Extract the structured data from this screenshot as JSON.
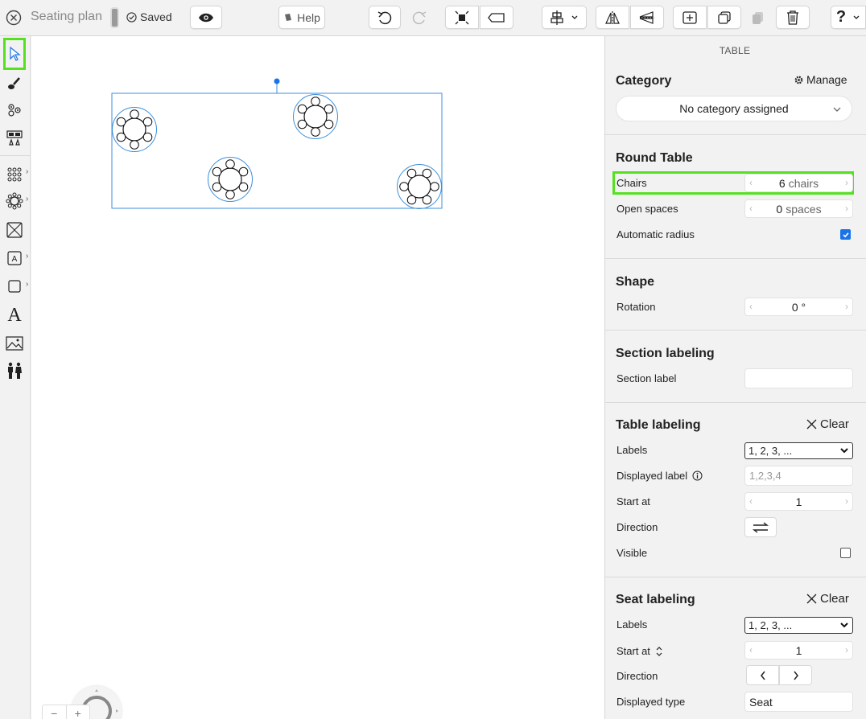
{
  "app": {
    "title": "Seating plan",
    "saved_label": "Saved",
    "help_label": "Help"
  },
  "toolbar": {
    "icons": [
      "close-icon",
      "eye-icon",
      "book-icon",
      "undo-icon",
      "redo-icon",
      "select-all-icon",
      "tag-icon",
      "align-icon",
      "flip-horizontal-icon",
      "flip-vertical-icon",
      "add-group-icon",
      "duplicate-icon",
      "paste-icon",
      "trash-icon",
      "help-icon"
    ]
  },
  "left_tools": [
    "select-icon",
    "brush-icon",
    "seats-icon",
    "tables-icon",
    "rows-icon",
    "round-table-icon",
    "area-icon",
    "label-icon",
    "shape-icon",
    "text-icon",
    "image-icon",
    "people-icon"
  ],
  "canvas": {
    "tables": [
      {
        "chairs": 6
      },
      {
        "chairs": 6
      },
      {
        "chairs": 6
      },
      {
        "chairs": 6
      }
    ]
  },
  "panel": {
    "title": "TABLE",
    "category": {
      "heading": "Category",
      "manage_label": "Manage",
      "selected": "No category assigned"
    },
    "round_table": {
      "heading": "Round Table",
      "chairs_label": "Chairs",
      "chairs_value": "6",
      "chairs_unit": "chairs",
      "open_spaces_label": "Open spaces",
      "open_spaces_value": "0",
      "open_spaces_unit": "spaces",
      "auto_radius_label": "Automatic radius",
      "auto_radius_checked": true
    },
    "shape": {
      "heading": "Shape",
      "rotation_label": "Rotation",
      "rotation_value": "0 °"
    },
    "section_labeling": {
      "heading": "Section labeling",
      "section_label_label": "Section label",
      "section_label_value": ""
    },
    "table_labeling": {
      "heading": "Table labeling",
      "clear_label": "Clear",
      "labels_label": "Labels",
      "labels_value": "1, 2, 3, ...",
      "displayed_label_label": "Displayed label",
      "displayed_label_placeholder": "1,2,3,4",
      "start_at_label": "Start at",
      "start_at_value": "1",
      "direction_label": "Direction",
      "visible_label": "Visible",
      "visible_checked": false
    },
    "seat_labeling": {
      "heading": "Seat labeling",
      "clear_label": "Clear",
      "labels_label": "Labels",
      "labels_value": "1, 2, 3, ...",
      "start_at_label": "Start at",
      "start_at_value": "1",
      "direction_label": "Direction",
      "displayed_type_label": "Displayed type",
      "displayed_type_value": "Seat"
    }
  },
  "zoom": {
    "minus": "−",
    "plus": "+"
  },
  "colors": {
    "highlight": "#55e11f",
    "selection": "#3c8fdb",
    "checkbox": "#1a73e8"
  }
}
